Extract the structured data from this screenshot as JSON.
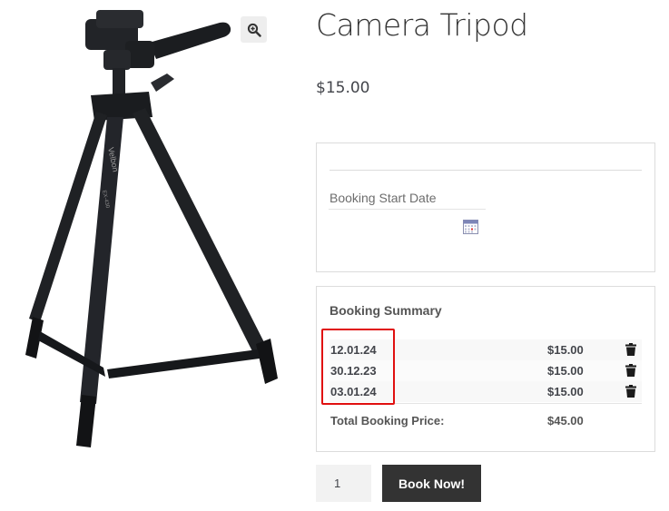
{
  "product": {
    "title": "Camera Tripod",
    "price": "$15.00",
    "image_alt": "tripod",
    "image_brand_text": "Velbon",
    "image_model_text": "EX-430"
  },
  "icons": {
    "zoom": "magnifier-plus-icon",
    "calendar": "calendar-icon",
    "delete": "trash-icon"
  },
  "booking_form": {
    "start_date_label": "Booking Start Date"
  },
  "summary": {
    "title": "Booking Summary",
    "rows": [
      {
        "date": "12.01.24",
        "amount": "$15.00"
      },
      {
        "date": "30.12.23",
        "amount": "$15.00"
      },
      {
        "date": "03.01.24",
        "amount": "$15.00"
      }
    ],
    "total_label": "Total Booking Price:",
    "total_amount": "$45.00"
  },
  "cart": {
    "quantity": "1",
    "book_label": "Book Now!"
  },
  "colors": {
    "highlight": "#e01010",
    "button_bg": "#333333"
  }
}
